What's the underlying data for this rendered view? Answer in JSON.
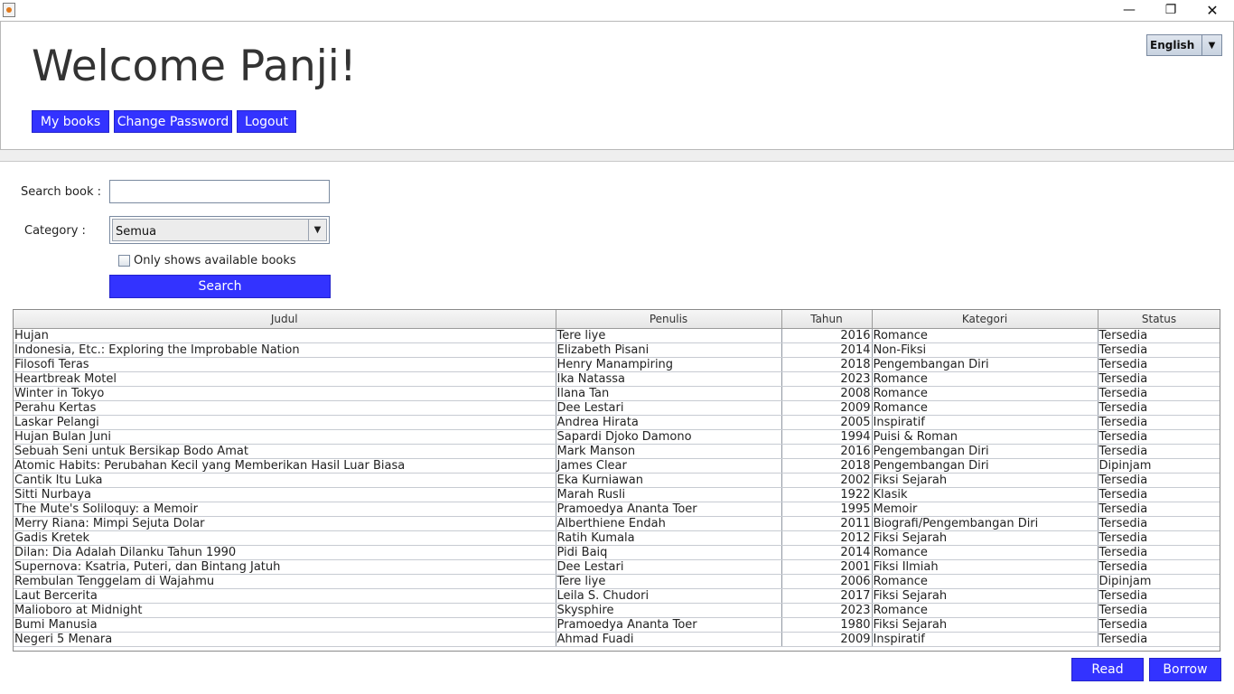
{
  "window": {
    "minimize": "—",
    "maximize": "❐",
    "close": "✕"
  },
  "header": {
    "welcome": "Welcome Panji!",
    "buttons": {
      "my_books": "My books",
      "change_password": "Change Password",
      "logout": "Logout"
    },
    "language": {
      "selected": "English"
    }
  },
  "search": {
    "label": "Search book :",
    "value": "",
    "placeholder": "",
    "category_label": "Category :",
    "category_selected": "Semua",
    "available_only_label": "Only shows available books",
    "available_only_checked": false,
    "button": "Search"
  },
  "table": {
    "columns": [
      "Judul",
      "Penulis",
      "Tahun",
      "Kategori",
      "Status"
    ],
    "rows": [
      [
        "Hujan",
        "Tere liye",
        "2016",
        "Romance",
        "Tersedia"
      ],
      [
        "Indonesia, Etc.: Exploring the Improbable Nation",
        "Elizabeth Pisani",
        "2014",
        "Non-Fiksi",
        "Tersedia"
      ],
      [
        "Filosofi Teras",
        "Henry Manampiring",
        "2018",
        "Pengembangan Diri",
        "Tersedia"
      ],
      [
        "Heartbreak Motel",
        "Ika Natassa",
        "2023",
        "Romance",
        "Tersedia"
      ],
      [
        "Winter in Tokyo",
        "Ilana Tan",
        "2008",
        "Romance",
        "Tersedia"
      ],
      [
        "Perahu Kertas",
        "Dee Lestari",
        "2009",
        "Romance",
        "Tersedia"
      ],
      [
        "Laskar Pelangi",
        "Andrea Hirata",
        "2005",
        "Inspiratif",
        "Tersedia"
      ],
      [
        "Hujan Bulan Juni",
        "Sapardi Djoko Damono",
        "1994",
        "Puisi & Roman",
        "Tersedia"
      ],
      [
        "Sebuah Seni untuk Bersikap Bodo Amat",
        "Mark Manson",
        "2016",
        "Pengembangan Diri",
        "Tersedia"
      ],
      [
        "Atomic Habits: Perubahan Kecil yang Memberikan Hasil Luar Biasa",
        "James Clear",
        "2018",
        "Pengembangan Diri",
        "Dipinjam"
      ],
      [
        "Cantik Itu Luka",
        "Eka Kurniawan",
        "2002",
        "Fiksi Sejarah",
        "Tersedia"
      ],
      [
        "Sitti Nurbaya",
        "Marah Rusli",
        "1922",
        "Klasik",
        "Tersedia"
      ],
      [
        "The Mute's Soliloquy: a Memoir",
        "Pramoedya Ananta Toer",
        "1995",
        "Memoir",
        "Tersedia"
      ],
      [
        "Merry Riana: Mimpi Sejuta Dolar",
        "Alberthiene Endah",
        "2011",
        "Biografi/Pengembangan Diri",
        "Tersedia"
      ],
      [
        "Gadis Kretek",
        "Ratih Kumala",
        "2012",
        "Fiksi Sejarah",
        "Tersedia"
      ],
      [
        "Dilan: Dia Adalah Dilanku Tahun 1990",
        "Pidi Baiq",
        "2014",
        "Romance",
        "Tersedia"
      ],
      [
        "Supernova: Ksatria, Puteri, dan Bintang Jatuh",
        "Dee Lestari",
        "2001",
        "Fiksi Ilmiah",
        "Tersedia"
      ],
      [
        "Rembulan Tenggelam di Wajahmu",
        "Tere liye",
        "2006",
        "Romance",
        "Dipinjam"
      ],
      [
        "Laut Bercerita",
        "Leila S. Chudori",
        "2017",
        "Fiksi Sejarah",
        "Tersedia"
      ],
      [
        "Malioboro at Midnight",
        "Skysphire",
        "2023",
        "Romance",
        "Tersedia"
      ],
      [
        "Bumi Manusia",
        "Pramoedya Ananta Toer",
        "1980",
        "Fiksi Sejarah",
        "Tersedia"
      ],
      [
        "Negeri 5 Menara",
        "Ahmad Fuadi",
        "2009",
        "Inspiratif",
        "Tersedia"
      ]
    ]
  },
  "actions": {
    "read": "Read",
    "borrow": "Borrow"
  }
}
